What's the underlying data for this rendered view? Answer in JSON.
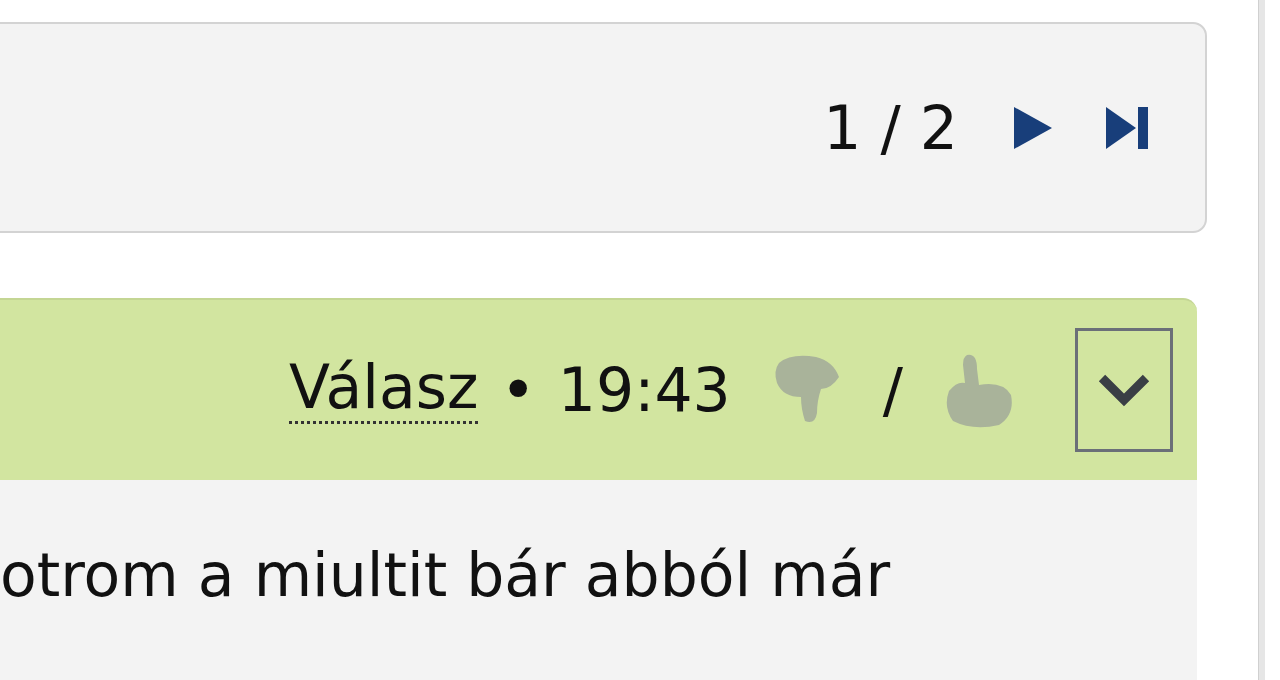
{
  "pager": {
    "position": "1 / 2"
  },
  "post": {
    "reply_link": "Válasz",
    "separator": "•",
    "time": "19:43",
    "vote_separator": "/",
    "body": "otrom a miultit bár abból már"
  }
}
